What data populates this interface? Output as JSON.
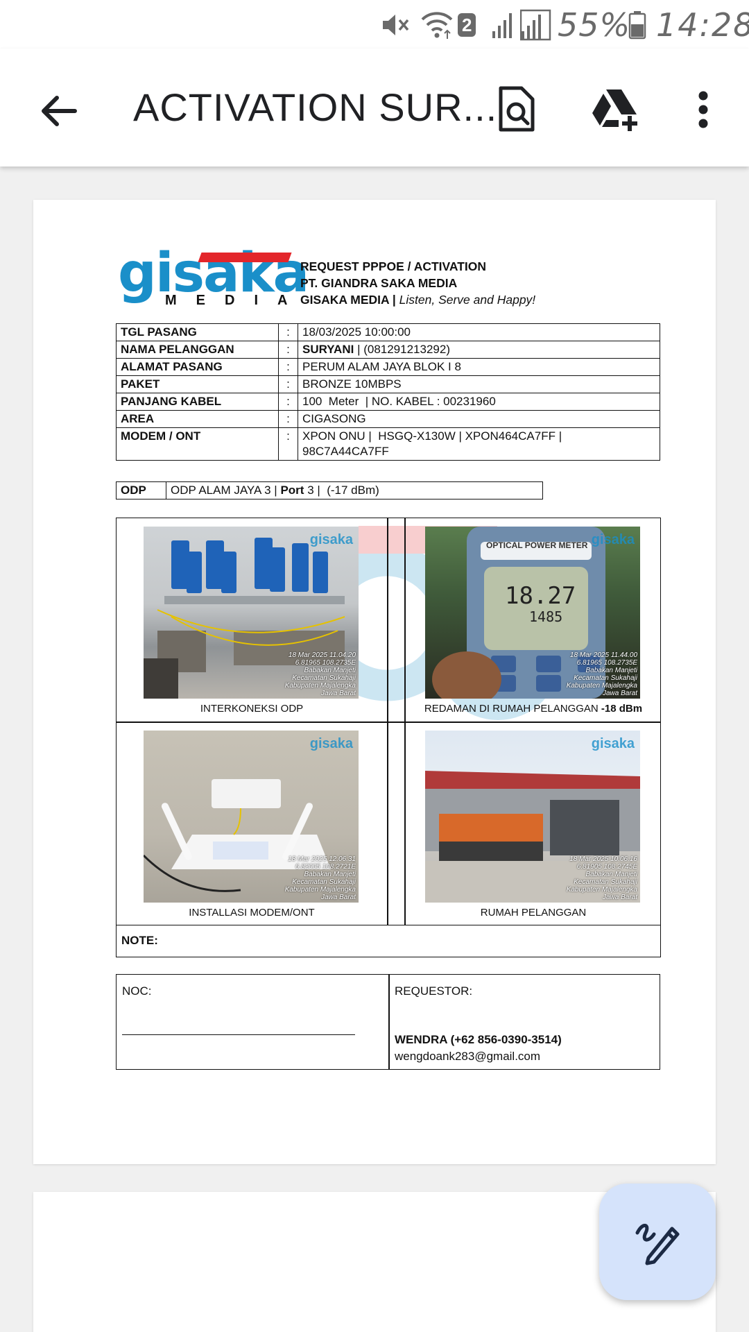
{
  "status_bar": {
    "sim_slot": "2",
    "battery": "55%",
    "time": "14:28",
    "icons": [
      "mute-icon",
      "wifi-icon",
      "signal-icon",
      "battery-icon"
    ]
  },
  "app_bar": {
    "title": "ACTIVATION SUR...",
    "icons": [
      "back-arrow-icon",
      "search-document-icon",
      "drive-add-icon",
      "more-vert-icon"
    ]
  },
  "document": {
    "logo": {
      "word_main": "gisaka",
      "word_sub": "MEDIA"
    },
    "header": {
      "line1": "REQUEST PPPOE / ACTIVATION",
      "line2": "PT. GIANDRA SAKA MEDIA",
      "line3_bold": "GISAKA MEDIA |",
      "line3_italic": "Listen, Serve and Happy!"
    },
    "info_rows": [
      {
        "key": "TGL PASANG",
        "value": "18/03/2025 10:00:00"
      },
      {
        "key": "NAMA PELANGGAN",
        "value_bold": "SURYANI",
        "value": "| (081291213292)"
      },
      {
        "key": "ALAMAT PASANG",
        "value": "PERUM ALAM JAYA BLOK I 8"
      },
      {
        "key": "PAKET",
        "value": "BRONZE 10MBPS"
      },
      {
        "key": "PANJANG KABEL",
        "value": "100  Meter  | NO. KABEL : 00231960"
      },
      {
        "key": "AREA",
        "value": "CIGASONG"
      },
      {
        "key": "MODEM / ONT",
        "value": "XPON ONU |  HSGQ-X130W | XPON464CA7FF |",
        "value2": "98C7A44CA7FF"
      }
    ],
    "separator": ":",
    "odp": {
      "key": "ODP",
      "value_a": "ODP ALAM JAYA 3 |",
      "port_label": "Port",
      "value_b": "3 |  (-17 dBm)"
    },
    "photos": [
      {
        "caption": "INTERKONEKSI ODP",
        "stamp": [
          "18 Mar 2025 11.04.20",
          "6.81965 108.2735E",
          "Babakan Manjeti",
          "Kecamatan Sukahaji",
          "Kabupaten Majalengka",
          "Jawa Barat"
        ]
      },
      {
        "caption": "REDAMAN DI RUMAH PELANGGAN",
        "caption_bold": "-18 dBm",
        "stamp": [
          "18 Mar 2025 11.44.00",
          "6.81965 108.2735E",
          "Babakan Manjeti",
          "Kecamatan Sukahaji",
          "Kabupaten Majalengka",
          "Jawa Barat"
        ],
        "meter_label": "OPTICAL POWER METER",
        "meter_reading": "18.27",
        "meter_sub": "1485"
      },
      {
        "caption": "INSTALLASI MODEM/ONT",
        "stamp": [
          "18 Mar 2025 12.06.31",
          "6.82005 108.2721E",
          "Babakan Manjeti",
          "Kecamatan Sukahaji",
          "Kabupaten Majalengka",
          "Jawa Barat"
        ]
      },
      {
        "caption": "RUMAH PELANGGAN",
        "stamp": [
          "18 Mar 2025 10.06.16",
          "6.81905 108.2745E",
          "Babakan Manjeti",
          "Kecamatan Sukahaji",
          "Kabupaten Majalengka",
          "Jawa Barat"
        ]
      }
    ],
    "photo_watermark": "gisaka",
    "note_label": "NOTE:",
    "noc_label": "NOC:",
    "requestor_label": "REQUESTOR:",
    "requestor_name": "WENDRA (+62 856-0390-3514)",
    "requestor_email": "wengdoank283@gmail.com"
  },
  "fab": {
    "icon": "edit-pen-icon"
  },
  "colors": {
    "brand_blue": "#1a8fc9",
    "brand_red": "#e3262b",
    "fab_bg": "#d5e3fb",
    "status_grey": "#6a6a6a"
  }
}
